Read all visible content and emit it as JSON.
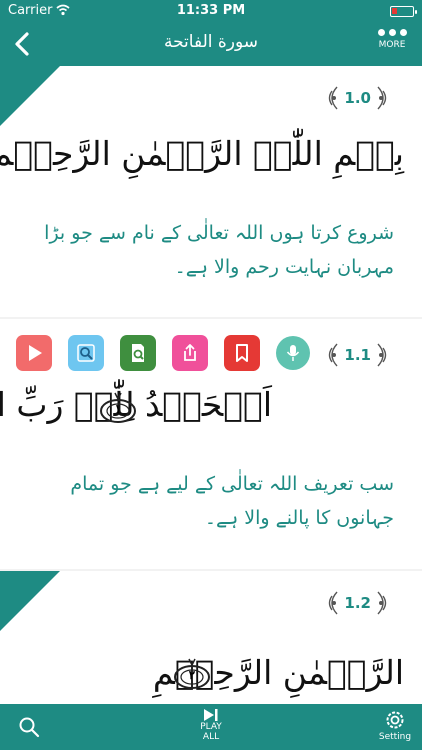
{
  "status_bar": {
    "carrier": "Carrier",
    "time": "11:33 PM",
    "battery_color": "#e53935"
  },
  "nav": {
    "title": "سورة الفاتحة",
    "more_label": "MORE"
  },
  "colors": {
    "accent": "#1e8b83",
    "background": "#f2f2f2"
  },
  "verses": [
    {
      "number": "1.0",
      "arabic": "بِسۡمِ اللّٰہِ الرَّحۡمٰنِ الرَّحِیۡمِ",
      "urdu": "شروع کرتا ہوں اللہ تعالٰی کے نام سے جو بڑا مہربان نہایت رحم والا ہے۔"
    },
    {
      "number": "1.1",
      "arabic": "اَلۡحَمۡدُ لِلّٰہِ رَبِّ الۡعٰلَمِیۡنَ",
      "ayah_mark": "١",
      "urdu": "سب تعریف اللہ تعالٰی کے لیے ہے جو تمام جہانوں کا پالنے والا ہے۔"
    },
    {
      "number": "1.2",
      "arabic": "الرَّحۡمٰنِ الرَّحِیۡمِ",
      "ayah_mark": "٢"
    }
  ],
  "tools": [
    {
      "name": "play-icon",
      "color": "#f26b6b"
    },
    {
      "name": "tafseer-search-icon",
      "color": "#6ec6f0"
    },
    {
      "name": "word-search-icon",
      "color": "#3f8f3f"
    },
    {
      "name": "share-icon",
      "color": "#f0509a"
    },
    {
      "name": "bookmark-icon",
      "color": "#e53935"
    },
    {
      "name": "microphone-icon",
      "color": "#5fc3b0"
    }
  ],
  "tab_bar": {
    "play_label_1": "PLAY",
    "play_label_2": "ALL",
    "setting_label": "Setting"
  }
}
